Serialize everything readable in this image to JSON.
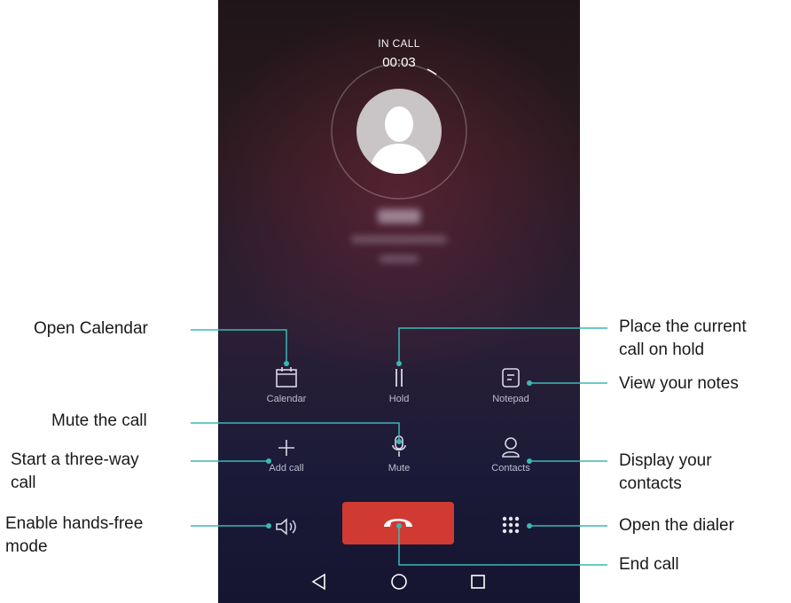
{
  "call": {
    "status": "IN CALL",
    "timer": "00:03"
  },
  "buttons": {
    "calendar": "Calendar",
    "hold": "Hold",
    "notepad": "Notepad",
    "add_call": "Add call",
    "mute": "Mute",
    "contacts": "Contacts"
  },
  "callouts": {
    "open_calendar": "Open Calendar",
    "mute_the_call": "Mute the call",
    "three_way_1": "Start a three-way",
    "three_way_2": "call",
    "hands_free_1": "Enable hands-free",
    "hands_free_2": "mode",
    "hold_1": "Place the current",
    "hold_2": "call on hold",
    "notes": "View your notes",
    "contacts_1": "Display your",
    "contacts_2": "contacts",
    "dialer": "Open the dialer",
    "end_call": "End call"
  },
  "colors": {
    "accent_line": "#3ab9b5",
    "end_call": "#d03a33"
  },
  "icons": [
    "calendar-icon",
    "hold-icon",
    "notepad-icon",
    "plus-icon",
    "microphone-icon",
    "contacts-icon",
    "speaker-icon",
    "end-call-icon",
    "dialpad-icon",
    "back-icon",
    "home-icon",
    "recents-icon"
  ]
}
